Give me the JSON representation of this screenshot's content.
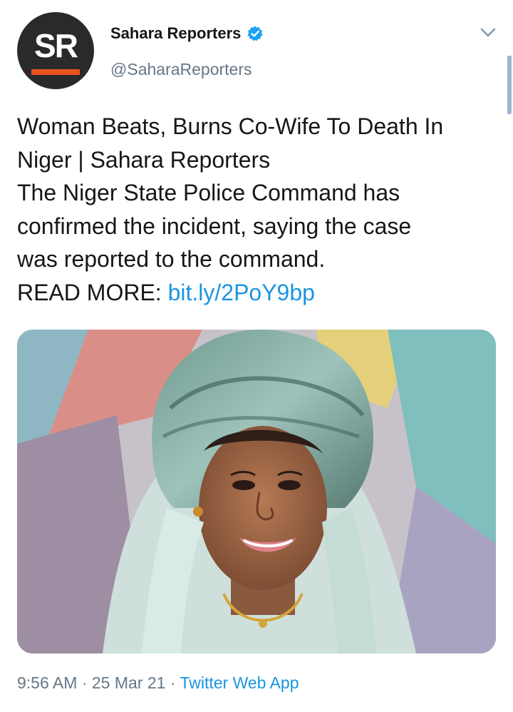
{
  "author": {
    "avatar_text": "SR",
    "display_name": "Sahara Reporters",
    "handle": "@SaharaReporters",
    "verified": true,
    "verified_icon": "verified-badge-icon"
  },
  "tweet": {
    "lines": [
      "Woman Beats, Burns Co-Wife To Death In",
      "Niger | Sahara Reporters",
      "The Niger State Police Command has",
      "confirmed the incident, saying the case",
      "was reported to the command."
    ],
    "read_more_label": "READ MORE:",
    "link_text": "bit.ly/2PoY9bp"
  },
  "meta": {
    "time": "9:56 AM",
    "separator": "·",
    "date": "25 Mar 21",
    "source": "Twitter Web App"
  },
  "colors": {
    "link": "#1b95e0",
    "secondary_text": "#657786",
    "avatar_bg": "#2a2a2a",
    "avatar_accent": "#e8531d"
  }
}
